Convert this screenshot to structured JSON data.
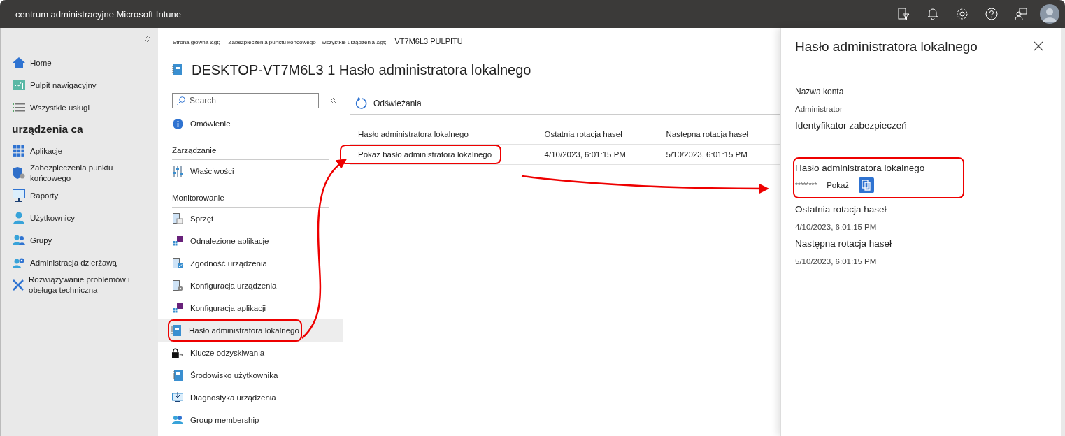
{
  "top_bar": {
    "title": "centrum administracyjne Microsoft Intune"
  },
  "nav": {
    "items": [
      {
        "kind": "item",
        "label": "Home"
      },
      {
        "kind": "item",
        "label": "Pulpit nawigacyjny"
      },
      {
        "kind": "item",
        "label": "Wszystkie usługi"
      },
      {
        "kind": "heading",
        "label": "urządzenia ca"
      },
      {
        "kind": "item",
        "label": "Aplikacje"
      },
      {
        "kind": "item",
        "label": "Zabezpieczenia punktu końcowego"
      },
      {
        "kind": "item",
        "label": "Raporty"
      },
      {
        "kind": "item",
        "label": "Użytkownicy"
      },
      {
        "kind": "item",
        "label": "Grupy"
      },
      {
        "kind": "item",
        "label": "Administracja dzierżawą"
      },
      {
        "kind": "item",
        "label": "Rozwiązywanie problemów i obsługa techniczna"
      }
    ]
  },
  "breadcrumb": [
    "Strona główna &gt;",
    "Zabezpieczenia punktu końcowego – wszystkie urządzenia &gt;",
    "VT7M6L3 PULPITU"
  ],
  "page_title": "DESKTOP-VT7M6L3 1 Hasło administratora lokalnego",
  "resource_menu": {
    "search": {
      "placeholder": "Search"
    },
    "items": [
      {
        "kind": "item",
        "label": "Omówienie",
        "selected": false,
        "highlighted": false
      },
      {
        "kind": "heading",
        "label": "Zarządzanie"
      },
      {
        "kind": "item",
        "label": "Właściwości",
        "selected": false,
        "highlighted": false
      },
      {
        "kind": "heading",
        "label": "Monitorowanie"
      },
      {
        "kind": "item",
        "label": "Sprzęt",
        "selected": false,
        "highlighted": false
      },
      {
        "kind": "item",
        "label": "Odnalezione aplikacje",
        "selected": false,
        "highlighted": false
      },
      {
        "kind": "item",
        "label": "Zgodność urządzenia",
        "selected": false,
        "highlighted": false
      },
      {
        "kind": "item",
        "label": "Konfiguracja urządzenia",
        "selected": false,
        "highlighted": false
      },
      {
        "kind": "item",
        "label": "Konfiguracja aplikacji",
        "selected": false,
        "highlighted": false
      },
      {
        "kind": "item",
        "label": "Hasło administratora lokalnego",
        "selected": true,
        "highlighted": true
      },
      {
        "kind": "item",
        "label": "Klucze odzyskiwania",
        "selected": false,
        "highlighted": false
      },
      {
        "kind": "item",
        "label": "Środowisko użytkownika",
        "selected": false,
        "highlighted": false
      },
      {
        "kind": "item",
        "label": "Diagnostyka urządzenia",
        "selected": false,
        "highlighted": false
      },
      {
        "kind": "item",
        "label": "Group membership",
        "selected": false,
        "highlighted": false
      }
    ]
  },
  "toolbar": {
    "refresh": "Odświeżania"
  },
  "table": {
    "columns": [
      "Hasło administratora lokalnego",
      "Ostatnia rotacja haseł",
      "Następna rotacja haseł"
    ],
    "rows": [
      {
        "cells": [
          "Pokaż hasło administratora lokalnego",
          "4/10/2023, 6:01:15 PM",
          "5/10/2023, 6:01:15 PM"
        ],
        "highlighted": true
      }
    ]
  },
  "panel": {
    "title": "Hasło administratora lokalnego",
    "fields": [
      {
        "kind": "text",
        "label": "Nazwa konta",
        "value": "Administrator",
        "highlighted": false
      },
      {
        "kind": "label",
        "label": "Identyfikator zabezpieczeń",
        "highlighted": false
      },
      {
        "kind": "secret",
        "label": "Hasło administratora lokalnego",
        "value": "********",
        "action": "Pokaż",
        "highlighted": true
      },
      {
        "kind": "text",
        "label": "Ostatnia rotacja haseł",
        "value": "4/10/2023, 6:01:15 PM",
        "highlighted": false
      },
      {
        "kind": "text",
        "label": "Następna rotacja haseł",
        "value": "5/10/2023, 6:01:15 PM",
        "highlighted": false
      }
    ]
  }
}
